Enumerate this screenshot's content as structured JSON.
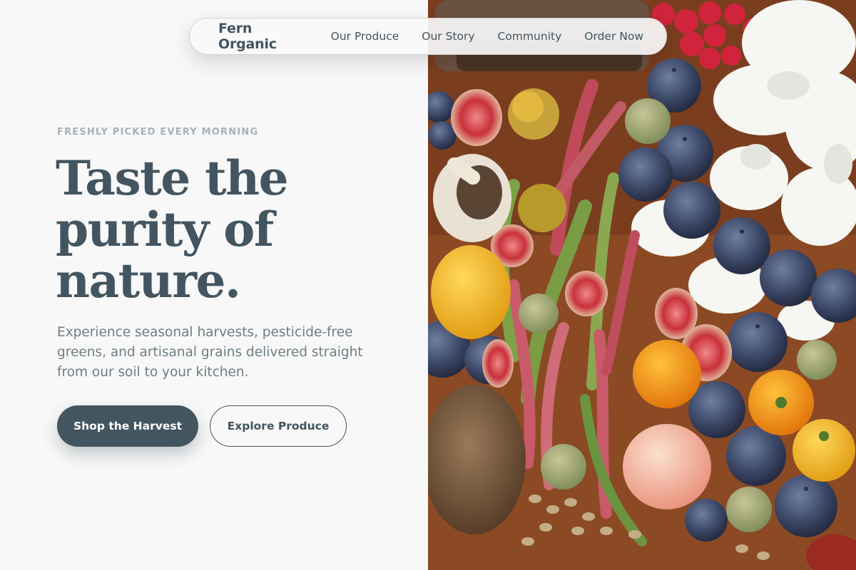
{
  "nav": {
    "brand": "Fern Organic",
    "links": [
      {
        "label": "Our Produce"
      },
      {
        "label": "Our Story"
      },
      {
        "label": "Community"
      },
      {
        "label": "Order Now"
      }
    ]
  },
  "hero": {
    "eyebrow": "FRESHLY PICKED EVERY MORNING",
    "headline_lines": [
      "Taste the",
      "purity of",
      "nature."
    ],
    "subcopy": "Experience seasonal harvests, pesticide-free greens, and artisanal grains delivered straight from our soil to your kitchen.",
    "primary_cta": "Shop the Harvest",
    "secondary_cta": "Explore Produce"
  },
  "colors": {
    "primary": "#435560",
    "muted": "#a6b2b8",
    "body_text": "#6e7d85",
    "background": "#f8f8f8"
  }
}
